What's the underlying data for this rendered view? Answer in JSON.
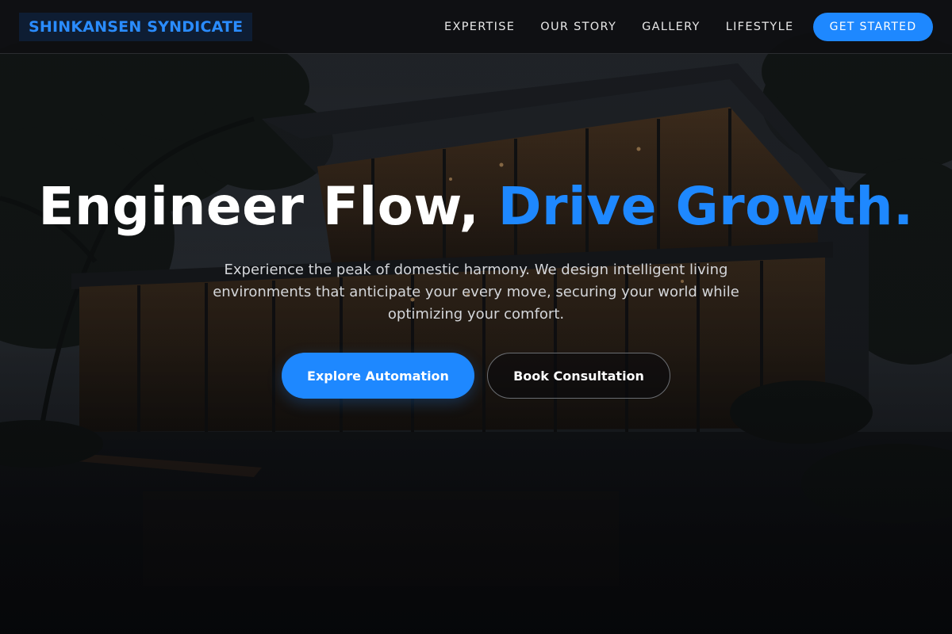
{
  "brand": {
    "name": "SHINKANSEN SYNDICATE"
  },
  "nav": {
    "items": [
      {
        "label": "EXPERTISE"
      },
      {
        "label": "OUR STORY"
      },
      {
        "label": "GALLERY"
      },
      {
        "label": "LIFESTYLE"
      }
    ],
    "cta_label": "GET STARTED"
  },
  "hero": {
    "title_part1": "Engineer Flow, ",
    "title_accent": "Drive Growth.",
    "subtitle": "Experience the peak of domestic harmony. We design intelligent living environments that anticipate your every move, securing your world while optimizing your comfort.",
    "primary_button": "Explore Automation",
    "secondary_button": "Book Consultation"
  },
  "background": {
    "image": "modern-house-at-dusk"
  },
  "colors": {
    "accent": "#1e88ff",
    "header_bg": "#0e0f11",
    "brand_bg": "#0e1d33",
    "text_primary": "#ffffff",
    "text_secondary": "#d4d6da"
  }
}
